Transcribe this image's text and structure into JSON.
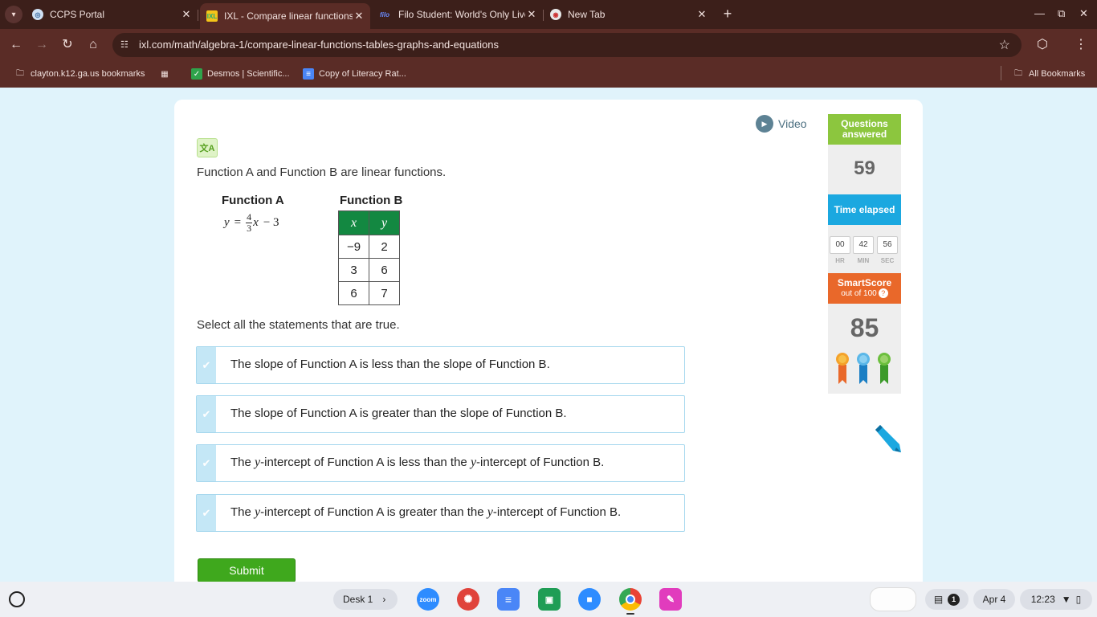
{
  "browser": {
    "tabs": [
      {
        "title": "CCPS Portal",
        "active": false
      },
      {
        "title": "IXL - Compare linear functions",
        "active": true
      },
      {
        "title": "Filo Student: World's Only Live",
        "active": false
      },
      {
        "title": "New Tab",
        "active": false
      }
    ],
    "url": "ixl.com/math/algebra-1/compare-linear-functions-tables-graphs-and-equations",
    "bookmarks": [
      "clayton.k12.ga.us bookmarks",
      "Desmos | Scientific...",
      "Copy of Literacy Rat..."
    ],
    "all_bookmarks": "All Bookmarks"
  },
  "lesson": {
    "video_label": "Video",
    "question": "Function A and Function B are linear functions.",
    "function_a": {
      "title": "Function A",
      "equation_lhs": "y",
      "equals": "=",
      "numerator": "4",
      "denominator": "3",
      "var": "x",
      "tail": "− 3"
    },
    "function_b": {
      "title": "Function B",
      "headers": [
        "x",
        "y"
      ],
      "rows": [
        [
          "−9",
          "2"
        ],
        [
          "3",
          "6"
        ],
        [
          "6",
          "7"
        ]
      ]
    },
    "instruction": "Select all the statements that are true.",
    "options": [
      {
        "before": "The slope of Function A is less than the slope of Function B.",
        "mid": "",
        "after": "",
        "end": ""
      },
      {
        "before": "The slope of Function A is greater than the slope of Function B.",
        "mid": "",
        "after": "",
        "end": ""
      },
      {
        "before": "The ",
        "mid": "y",
        "after": "-intercept of Function A is less than the ",
        "y2": "y",
        "end": "-intercept of Function B."
      },
      {
        "before": "The ",
        "mid": "y",
        "after": "-intercept of Function A is greater than the ",
        "y2": "y",
        "end": "-intercept of Function B."
      }
    ],
    "submit_label": "Submit"
  },
  "sidebar": {
    "questions_label": "Questions answered",
    "questions_value": "59",
    "time_label": "Time elapsed",
    "time": {
      "hr": "00",
      "min": "42",
      "sec": "56"
    },
    "time_units": {
      "hr": "HR",
      "min": "MIN",
      "sec": "SEC"
    },
    "smartscore_label": "SmartScore",
    "smartscore_sub": "out of 100",
    "smartscore_value": "85",
    "help_glyph": "?"
  },
  "shelf": {
    "desk_label": "Desk 1",
    "apps": [
      "zoom",
      "canvas",
      "docs",
      "classroom",
      "zoom-video",
      "chrome",
      "jamboard"
    ],
    "notifications": "1",
    "date": "Apr 4",
    "time": "12:23"
  },
  "colors": {
    "ixl_green": "#8cc63e",
    "ixl_blue": "#1ba8e0",
    "ixl_orange": "#e9682a",
    "table_header": "#138841",
    "submit": "#3fa81d"
  }
}
